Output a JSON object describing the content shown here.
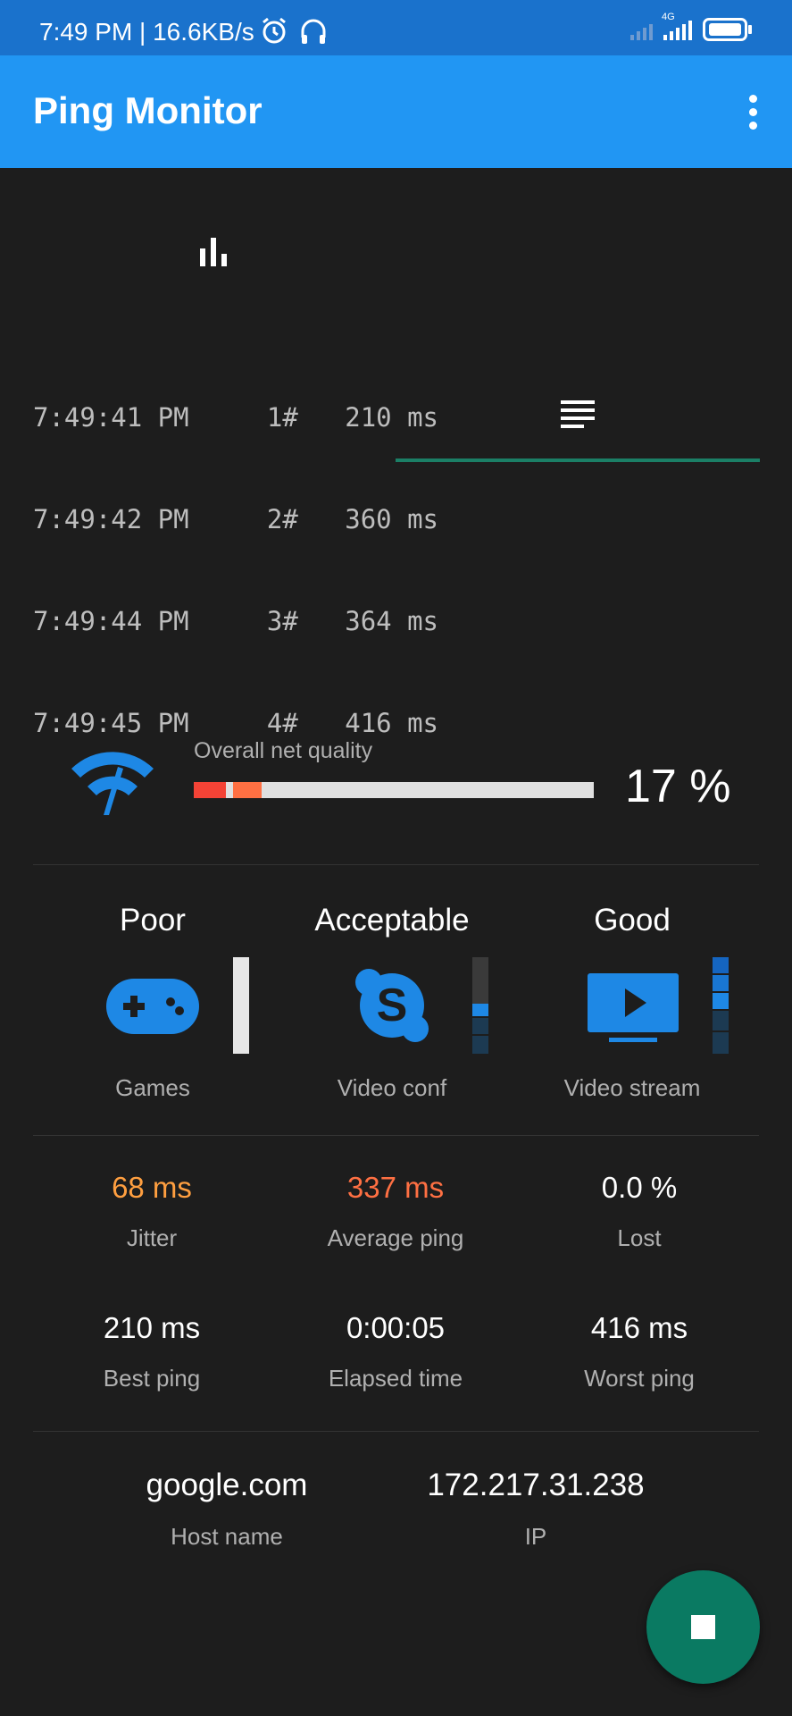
{
  "status_bar": {
    "time_speed": "7:49 PM | 16.6KB/s",
    "network": "4G"
  },
  "app_bar": {
    "title": "Ping Monitor"
  },
  "tabs": [
    {
      "icon": "bar-chart-icon",
      "selected": false
    },
    {
      "icon": "list-icon",
      "selected": true
    }
  ],
  "log": [
    {
      "time": "7:49:41 PM",
      "seq": "1#",
      "ping": "210 ms"
    },
    {
      "time": "7:49:42 PM",
      "seq": "2#",
      "ping": "360 ms"
    },
    {
      "time": "7:49:44 PM",
      "seq": "3#",
      "ping": "364 ms"
    },
    {
      "time": "7:49:45 PM",
      "seq": "4#",
      "ping": "416 ms"
    }
  ],
  "quality": {
    "label": "Overall net quality",
    "percent_text": "17 %",
    "percent": 17,
    "colors": {
      "red": "#f44336",
      "orange": "#ff7043"
    }
  },
  "categories": [
    {
      "rating": "Poor",
      "name": "Games",
      "icon": "gamepad-icon"
    },
    {
      "rating": "Acceptable",
      "name": "Video conf",
      "icon": "skype-icon"
    },
    {
      "rating": "Good",
      "name": "Video stream",
      "icon": "tv-play-icon"
    }
  ],
  "stats": {
    "jitter": {
      "value": "68 ms",
      "label": "Jitter",
      "color": "#ff9f40"
    },
    "average": {
      "value": "337 ms",
      "label": "Average ping",
      "color": "#ff7043"
    },
    "lost": {
      "value": "0.0 %",
      "label": "Lost"
    },
    "best": {
      "value": "210 ms",
      "label": "Best ping"
    },
    "elapsed": {
      "value": "0:00:05",
      "label": "Elapsed time"
    },
    "worst": {
      "value": "416 ms",
      "label": "Worst ping"
    }
  },
  "host": {
    "name": "google.com",
    "name_label": "Host name",
    "ip": "172.217.31.238",
    "ip_label": "IP"
  },
  "accent": "#2196f3"
}
